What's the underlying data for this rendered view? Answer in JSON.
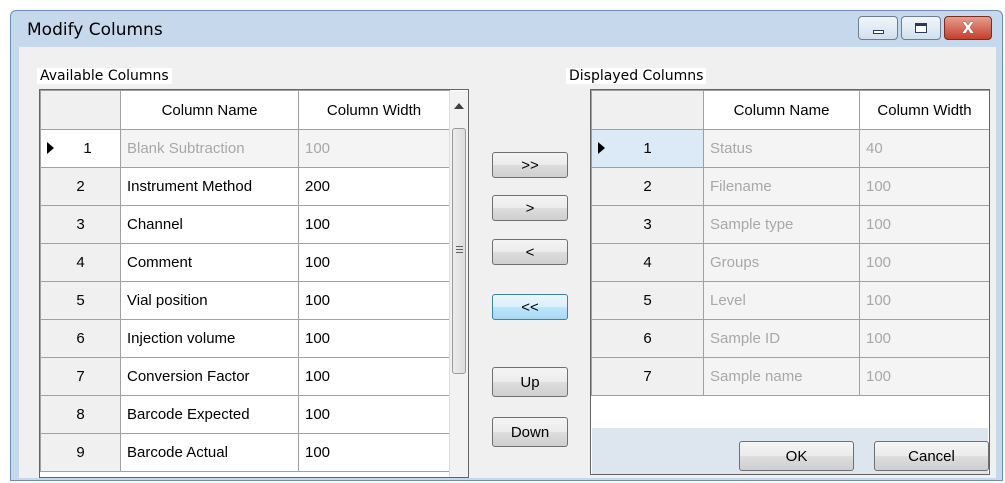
{
  "window": {
    "title": "Modify Columns",
    "caption_buttons": [
      "minimize-icon",
      "maximize-icon",
      "close-icon"
    ],
    "close_glyph": "X"
  },
  "available": {
    "label": "Available Columns",
    "headers": {
      "name": "Column Name",
      "width": "Column Width"
    },
    "rows": [
      {
        "num": "1",
        "name": "Blank Subtraction",
        "width": "100"
      },
      {
        "num": "2",
        "name": "Instrument Method",
        "width": "200"
      },
      {
        "num": "3",
        "name": "Channel",
        "width": "100"
      },
      {
        "num": "4",
        "name": "Comment",
        "width": "100"
      },
      {
        "num": "5",
        "name": "Vial position",
        "width": "100"
      },
      {
        "num": "6",
        "name": "Injection volume",
        "width": "100"
      },
      {
        "num": "7",
        "name": "Conversion Factor",
        "width": "100"
      },
      {
        "num": "8",
        "name": "Barcode Expected",
        "width": "100"
      },
      {
        "num": "9",
        "name": "Barcode Actual",
        "width": "100"
      }
    ]
  },
  "displayed": {
    "label": "Displayed Columns",
    "headers": {
      "name": "Column Name",
      "width": "Column Width"
    },
    "rows": [
      {
        "num": "1",
        "name": "Status",
        "width": "40"
      },
      {
        "num": "2",
        "name": "Filename",
        "width": "100"
      },
      {
        "num": "3",
        "name": "Sample type",
        "width": "100"
      },
      {
        "num": "4",
        "name": "Groups",
        "width": "100"
      },
      {
        "num": "5",
        "name": "Level",
        "width": "100"
      },
      {
        "num": "6",
        "name": "Sample ID",
        "width": "100"
      },
      {
        "num": "7",
        "name": "Sample name",
        "width": "100"
      }
    ]
  },
  "buttons": {
    "add_all": ">>",
    "add": ">",
    "remove": "<",
    "remove_all": "<<",
    "up": "Up",
    "down": "Down",
    "ok": "OK",
    "cancel": "Cancel"
  },
  "colors": {
    "frame": "#c5d8ec",
    "close_button": "#c3402c",
    "focus_button": "#3c7fb1"
  }
}
